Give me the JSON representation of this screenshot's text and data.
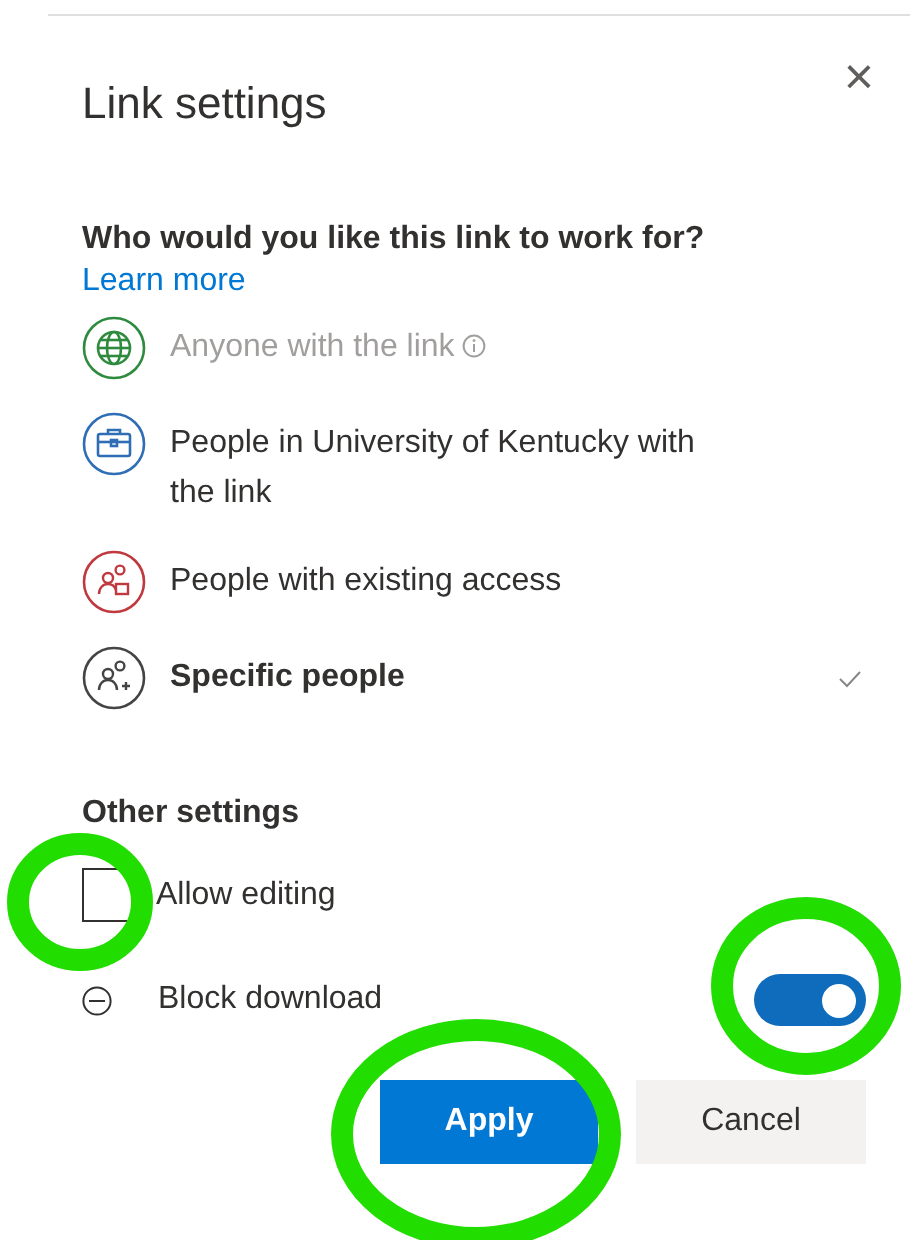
{
  "dialog": {
    "title": "Link settings",
    "close_label": "×"
  },
  "audience": {
    "question": "Who would you like this link to work for?",
    "learn_more": "Learn more",
    "options": [
      {
        "kind": "globe",
        "label": "Anyone with the link",
        "info": true,
        "disabled": true,
        "selected": false,
        "color": "#2e8b3e"
      },
      {
        "kind": "briefcase",
        "label": "People in University of Kentucky with the link",
        "info": false,
        "disabled": false,
        "selected": false,
        "color": "#2f6db5"
      },
      {
        "kind": "restricted",
        "label": "People with existing access",
        "info": false,
        "disabled": false,
        "selected": false,
        "color": "#c0393f"
      },
      {
        "kind": "people",
        "label": "Specific people",
        "info": false,
        "disabled": false,
        "selected": true,
        "color": "#444444"
      }
    ]
  },
  "other_settings": {
    "heading": "Other settings",
    "items": [
      {
        "kind": "checkbox",
        "label": "Allow editing",
        "checked": false
      },
      {
        "kind": "toggle",
        "label": "Block download",
        "on": true
      }
    ]
  },
  "buttons": [
    {
      "kind": "primary",
      "label": "Apply"
    },
    {
      "kind": "secondary",
      "label": "Cancel"
    }
  ]
}
